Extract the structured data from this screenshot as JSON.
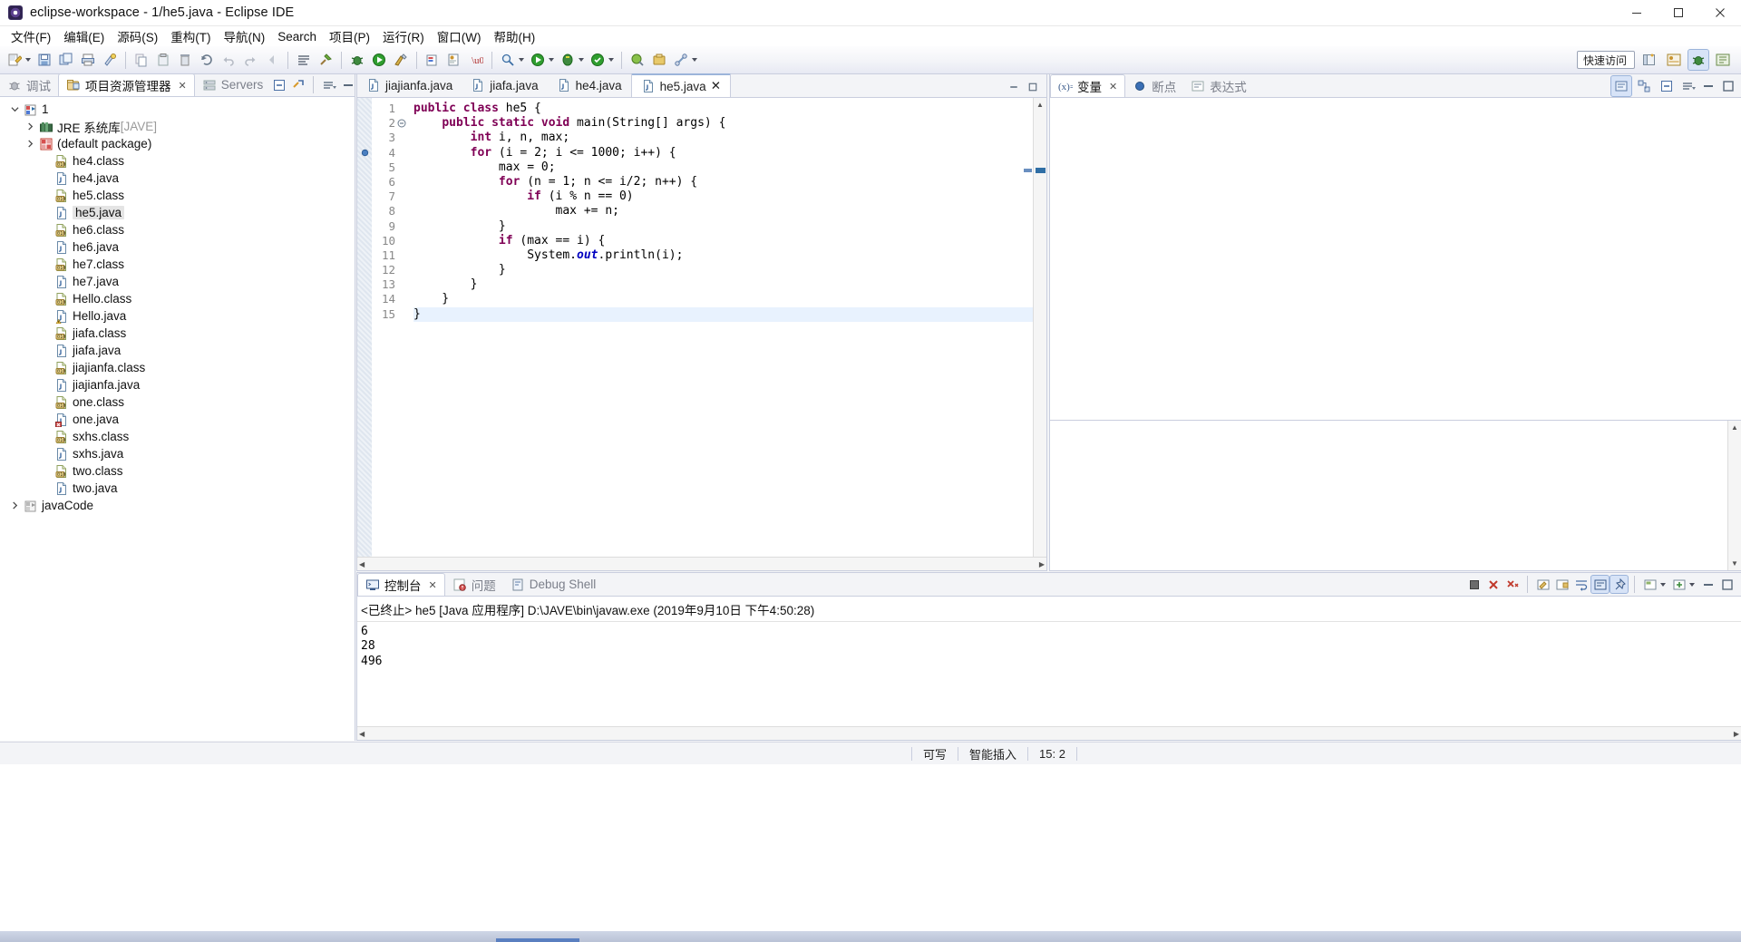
{
  "window": {
    "title": "eclipse-workspace - 1/he5.java - Eclipse IDE",
    "app_icon": "eclipse-icon",
    "minimize": "─",
    "maximize": "❐",
    "close": "✕"
  },
  "menubar": {
    "items": [
      {
        "label": "文件(F)",
        "name": "menu-file"
      },
      {
        "label": "编辑(E)",
        "name": "menu-edit"
      },
      {
        "label": "源码(S)",
        "name": "menu-source"
      },
      {
        "label": "重构(T)",
        "name": "menu-refactor"
      },
      {
        "label": "导航(N)",
        "name": "menu-navigate"
      },
      {
        "label": "Search",
        "name": "menu-search"
      },
      {
        "label": "项目(P)",
        "name": "menu-project"
      },
      {
        "label": "运行(R)",
        "name": "menu-run"
      },
      {
        "label": "窗口(W)",
        "name": "menu-window"
      },
      {
        "label": "帮助(H)",
        "name": "menu-help"
      }
    ]
  },
  "toolbar": {
    "quick_access": "快速访问",
    "quick_access_placeholder": "快速访问"
  },
  "left_panel": {
    "tabs": [
      {
        "label": "调试",
        "name": "tab-debug",
        "active": false,
        "closable": false
      },
      {
        "label": "项目资源管理器",
        "name": "tab-package-explorer",
        "active": true,
        "closable": true
      },
      {
        "label": "Servers",
        "name": "tab-servers",
        "active": false,
        "closable": false
      }
    ],
    "tree": [
      {
        "label": "1",
        "indent": 0,
        "twisty": "open",
        "icon": "java-project-icon",
        "selected": false
      },
      {
        "label": "JRE 系统库",
        "suffix": " [JAVE]",
        "indent": 1,
        "twisty": "closed",
        "icon": "jre-library-icon",
        "selected": false
      },
      {
        "label": "(default package)",
        "indent": 1,
        "twisty": "closed",
        "icon": "package-icon",
        "selected": false
      },
      {
        "label": "he4.class",
        "indent": 2,
        "twisty": "none",
        "icon": "class-file-icon",
        "selected": false
      },
      {
        "label": "he4.java",
        "indent": 2,
        "twisty": "none",
        "icon": "java-file-icon",
        "selected": false
      },
      {
        "label": "he5.class",
        "indent": 2,
        "twisty": "none",
        "icon": "class-file-icon",
        "selected": false
      },
      {
        "label": "he5.java",
        "indent": 2,
        "twisty": "none",
        "icon": "java-file-icon",
        "selected": true
      },
      {
        "label": "he6.class",
        "indent": 2,
        "twisty": "none",
        "icon": "class-file-icon",
        "selected": false
      },
      {
        "label": "he6.java",
        "indent": 2,
        "twisty": "none",
        "icon": "java-file-icon",
        "selected": false
      },
      {
        "label": "he7.class",
        "indent": 2,
        "twisty": "none",
        "icon": "class-file-icon",
        "selected": false
      },
      {
        "label": "he7.java",
        "indent": 2,
        "twisty": "none",
        "icon": "java-file-icon",
        "selected": false
      },
      {
        "label": "Hello.class",
        "indent": 2,
        "twisty": "none",
        "icon": "class-file-icon",
        "selected": false
      },
      {
        "label": "Hello.java",
        "indent": 2,
        "twisty": "none",
        "icon": "java-file-warning-icon",
        "selected": false
      },
      {
        "label": "jiafa.class",
        "indent": 2,
        "twisty": "none",
        "icon": "class-file-icon",
        "selected": false
      },
      {
        "label": "jiafa.java",
        "indent": 2,
        "twisty": "none",
        "icon": "java-file-icon",
        "selected": false
      },
      {
        "label": "jiajianfa.class",
        "indent": 2,
        "twisty": "none",
        "icon": "class-file-icon",
        "selected": false
      },
      {
        "label": "jiajianfa.java",
        "indent": 2,
        "twisty": "none",
        "icon": "java-file-icon",
        "selected": false
      },
      {
        "label": "one.class",
        "indent": 2,
        "twisty": "none",
        "icon": "class-file-icon",
        "selected": false
      },
      {
        "label": "one.java",
        "indent": 2,
        "twisty": "none",
        "icon": "java-file-error-icon",
        "selected": false
      },
      {
        "label": "sxhs.class",
        "indent": 2,
        "twisty": "none",
        "icon": "class-file-icon",
        "selected": false
      },
      {
        "label": "sxhs.java",
        "indent": 2,
        "twisty": "none",
        "icon": "java-file-icon",
        "selected": false
      },
      {
        "label": "two.class",
        "indent": 2,
        "twisty": "none",
        "icon": "class-file-icon",
        "selected": false
      },
      {
        "label": "two.java",
        "indent": 2,
        "twisty": "none",
        "icon": "java-file-icon",
        "selected": false
      },
      {
        "label": "javaCode",
        "indent": 0,
        "twisty": "closed",
        "icon": "project-closed-icon",
        "selected": false
      }
    ]
  },
  "editor": {
    "tabs": [
      {
        "label": "jiajianfa.java",
        "name": "editor-tab-jiajianfa",
        "active": false,
        "closable": false
      },
      {
        "label": "jiafa.java",
        "name": "editor-tab-jiafa",
        "active": false,
        "closable": false
      },
      {
        "label": "he4.java",
        "name": "editor-tab-he4",
        "active": false,
        "closable": false
      },
      {
        "label": "he5.java",
        "name": "editor-tab-he5",
        "active": true,
        "closable": true
      }
    ],
    "filename": "he5.java",
    "lines": [
      {
        "no": "1",
        "fold": "none",
        "breakpoint": false,
        "html": "<span class=\"kw\">public class</span> he5 {",
        "current": false
      },
      {
        "no": "2",
        "fold": "collapse",
        "breakpoint": false,
        "html": "    <span class=\"kw\">public static void</span> main(String[] args) {",
        "current": false
      },
      {
        "no": "3",
        "fold": "none",
        "breakpoint": false,
        "html": "        <span class=\"kw\">int</span> i, n, max;",
        "current": false
      },
      {
        "no": "4",
        "fold": "none",
        "breakpoint": true,
        "html": "        <span class=\"kw\">for</span> (i = 2; i &lt;= 1000; i++) {",
        "current": false
      },
      {
        "no": "5",
        "fold": "none",
        "breakpoint": false,
        "html": "            max = 0;",
        "current": false
      },
      {
        "no": "6",
        "fold": "none",
        "breakpoint": false,
        "html": "            <span class=\"kw\">for</span> (n = 1; n &lt;= i/2; n++) {",
        "current": false
      },
      {
        "no": "7",
        "fold": "none",
        "breakpoint": false,
        "html": "                <span class=\"kw\">if</span> (i % n == 0)",
        "current": false
      },
      {
        "no": "8",
        "fold": "none",
        "breakpoint": false,
        "html": "                    max += n;",
        "current": false
      },
      {
        "no": "9",
        "fold": "none",
        "breakpoint": false,
        "html": "            }",
        "current": false
      },
      {
        "no": "10",
        "fold": "none",
        "breakpoint": false,
        "html": "            <span class=\"kw\">if</span> (max == i) {",
        "current": false
      },
      {
        "no": "11",
        "fold": "none",
        "breakpoint": false,
        "html": "                System.<span class=\"stat\">out</span>.println(i);",
        "current": false
      },
      {
        "no": "12",
        "fold": "none",
        "breakpoint": false,
        "html": "            }",
        "current": false
      },
      {
        "no": "13",
        "fold": "none",
        "breakpoint": false,
        "html": "        }",
        "current": false
      },
      {
        "no": "14",
        "fold": "none",
        "breakpoint": false,
        "html": "    }",
        "current": false
      },
      {
        "no": "15",
        "fold": "none",
        "breakpoint": false,
        "html": "}",
        "current": true
      }
    ],
    "source_text": "public class he5 {\n    public static void main(String[] args) {\n        int i, n, max;\n        for (i = 2; i <= 1000; i++) {\n            max = 0;\n            for (n = 1; n <= i/2; n++) {\n                if (i % n == 0)\n                    max += n;\n            }\n            if (max == i) {\n                System.out.println(i);\n            }\n        }\n    }\n}"
  },
  "right_panel": {
    "tabs": [
      {
        "label": "变量",
        "name": "tab-variables",
        "active": true,
        "closable": true
      },
      {
        "label": "断点",
        "name": "tab-breakpoints",
        "active": false,
        "closable": false
      },
      {
        "label": "表达式",
        "name": "tab-expressions",
        "active": false,
        "closable": false
      }
    ]
  },
  "console": {
    "tabs": [
      {
        "label": "控制台",
        "name": "tab-console",
        "active": true,
        "closable": true
      },
      {
        "label": "问题",
        "name": "tab-problems",
        "active": false,
        "closable": false
      },
      {
        "label": "Debug Shell",
        "name": "tab-debug-shell",
        "active": false,
        "closable": false
      }
    ],
    "header": "<已终止> he5 [Java 应用程序] D:\\JAVE\\bin\\javaw.exe  (2019年9月10日 下午4:50:28)",
    "output_lines": [
      "6",
      "28",
      "496"
    ]
  },
  "statusbar": {
    "writable": "可写",
    "insert_mode": "智能插入",
    "cursor_position": "15: 2"
  }
}
